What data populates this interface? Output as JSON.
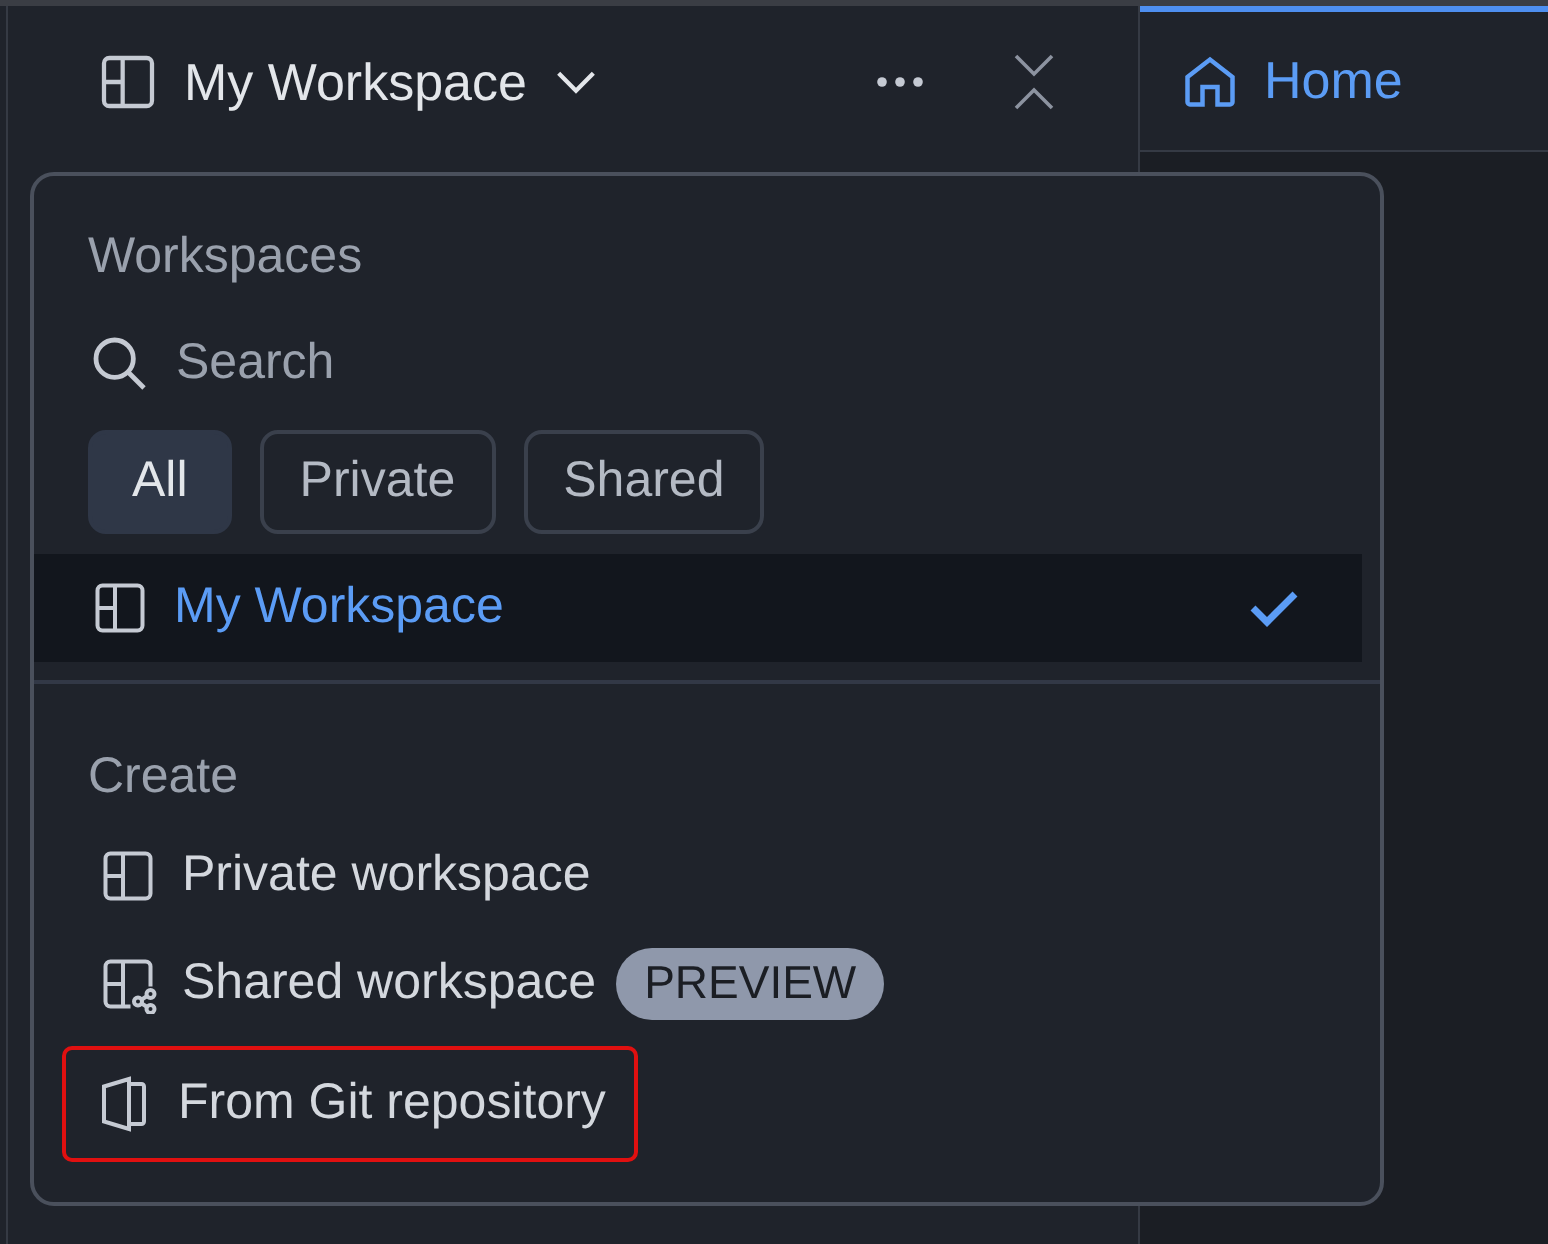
{
  "header": {
    "workspace_name": "My Workspace"
  },
  "tabs": [
    {
      "label": "Home",
      "selected": true
    }
  ],
  "menu": {
    "title": "Workspaces",
    "search": {
      "placeholder": "Search"
    },
    "filters": [
      {
        "label": "All",
        "selected": true
      },
      {
        "label": "Private",
        "selected": false
      },
      {
        "label": "Shared",
        "selected": false
      }
    ],
    "workspaces": [
      {
        "name": "My Workspace",
        "selected": true
      }
    ],
    "create_title": "Create",
    "create_items": [
      {
        "kind": "private",
        "label": "Private workspace",
        "highlighted": false
      },
      {
        "kind": "shared",
        "label": "Shared workspace",
        "badge": "PREVIEW",
        "highlighted": false
      },
      {
        "kind": "git",
        "label": "From Git repository",
        "highlighted": true
      }
    ]
  }
}
